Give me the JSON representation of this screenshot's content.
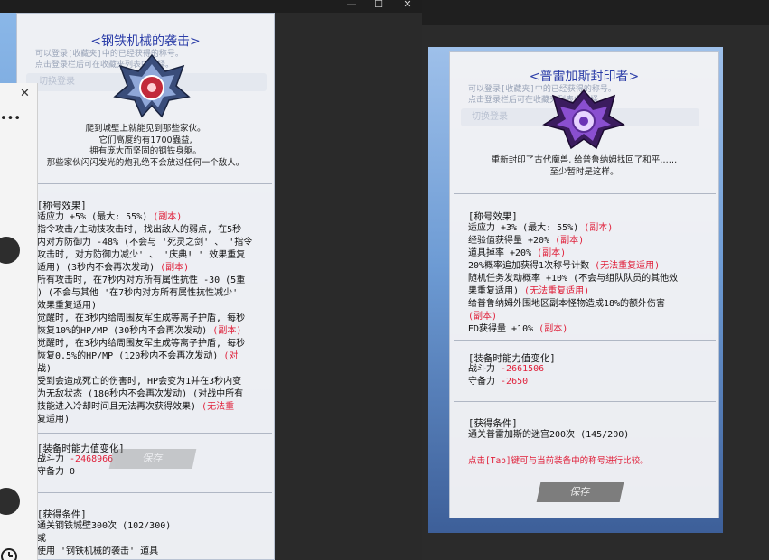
{
  "left_window": {
    "controls": {
      "minimize": "—",
      "maximize": "☐",
      "close": "✕"
    }
  },
  "left_tooltip": {
    "title": "<钢铁机械的袭击>",
    "description": [
      "爬到城壁上就能见到那些家伙。",
      "它们高度约有1700蟲益,",
      "拥有庞大而坚固的钢铁身躯。",
      "那些家伙闪闪发光的炮孔绝不会放过任何一个敌人。"
    ],
    "effects_title": "[称号效果]",
    "effects": [
      {
        "text": "适应力 +5% (最大: 55%)",
        "tag": "(副本)"
      },
      {
        "text": "指令攻击/主动技攻击时, 找出敌人的弱点, 在5秒",
        "tag": ""
      },
      {
        "text": "内对方防御力 -48% (不会与 '死灵之剑' 、 '指令",
        "tag": ""
      },
      {
        "text": "攻击时, 对方防御力减少' 、 '庆典! ' 效果重复",
        "tag": ""
      },
      {
        "text": "适用) (3秒内不会再次发动)",
        "tag": "(副本)"
      },
      {
        "text": "所有攻击时, 在7秒内对方所有属性抗性 -30 (5重",
        "tag": ""
      },
      {
        "text": ") (不会与其他 '在7秒内对方所有属性抗性减少'",
        "tag": ""
      },
      {
        "text": "效果重复适用)",
        "tag": ""
      },
      {
        "text": "觉醒时, 在3秒内给周围友军生成等离子护盾, 每秒",
        "tag": ""
      },
      {
        "text": "恢复10%的HP/MP (30秒内不会再次发动)",
        "tag": "(副本)"
      },
      {
        "text": "觉醒时, 在3秒内给周围友军生成等离子护盾, 每秒",
        "tag": ""
      },
      {
        "text": "恢复0.5%的HP/MP (120秒内不会再次发动)",
        "tag": "(对"
      },
      {
        "text": "战)",
        "tag": ""
      },
      {
        "text": "受到会造成死亡的伤害时, HP会变为1并在3秒内变",
        "tag": ""
      },
      {
        "text": "为无敌状态 (180秒内不会再次发动) (对战中所有",
        "tag": ""
      },
      {
        "text": "技能进入冷却时间且无法再次获得效果)",
        "tag": "(无法重"
      },
      {
        "text": "复适用)",
        "tag": ""
      }
    ],
    "equip_title": "[装备时能力值变化]",
    "equip": [
      {
        "label": "战斗力",
        "value": "-2468966"
      },
      {
        "label": "守备力",
        "value": "0"
      }
    ],
    "acquire_title": "[获得条件]",
    "acquire": [
      "通关钢铁城壁300次 (102/300)",
      "或",
      "使用 '钢铁机械的袭击' 道具"
    ],
    "login_hint": [
      "可以登录[收藏夹]中的已经获得的称号。",
      "点击登录栏后可在收藏夹列表中选择。"
    ],
    "switch_login": "切换登录",
    "save": "保存"
  },
  "chat_panel": {
    "close": "✕",
    "more": "•••",
    "clock_icon": "clock-icon"
  },
  "right_tooltip": {
    "title": "<普雷加斯封印者>",
    "description": [
      "重新封印了古代魔兽, 给普鲁纳姆找回了和平……",
      "至少暂时是这样。"
    ],
    "effects_title": "[称号效果]",
    "effects": [
      {
        "text": "适应力 +3% (最大: 55%)",
        "tag": "(副本)"
      },
      {
        "text": "经验值获得量 +20%",
        "tag": "(副本)"
      },
      {
        "text": "道具掉率 +20%",
        "tag": "(副本)"
      },
      {
        "text": "20%概率追加获得1次称号计数",
        "tag": "(无法重复适用)"
      },
      {
        "text": "随机任务发动概率 +10% (不会与组队队员的其他效",
        "tag": ""
      },
      {
        "text": "果重复适用)",
        "tag": "(无法重复适用)"
      },
      {
        "text": "给普鲁纳姆外围地区副本怪物造成18%的额外伤害",
        "tag": ""
      },
      {
        "text": "",
        "tag": "(副本)"
      },
      {
        "text": "ED获得量 +10%",
        "tag": "(副本)"
      }
    ],
    "equip_title": "[装备时能力值变化]",
    "equip": [
      {
        "label": "战斗力",
        "value": "-2661506"
      },
      {
        "label": "守备力",
        "value": "-2650"
      }
    ],
    "acquire_title": "[获得条件]",
    "acquire": [
      "通关普雷加斯的迷宫200次 (145/200)"
    ],
    "tab_hint": "点击[Tab]键可与当前装备中的称号进行比较。",
    "login_hint": [
      "可以登录[收藏夹]中的已经获得的称号。",
      "点击登录栏后可在收藏夹列表中选择。"
    ],
    "switch_login": "切换登录",
    "save": "保存"
  },
  "colors": {
    "title": "#2c3ea8",
    "tag_red": "#e0203a"
  }
}
